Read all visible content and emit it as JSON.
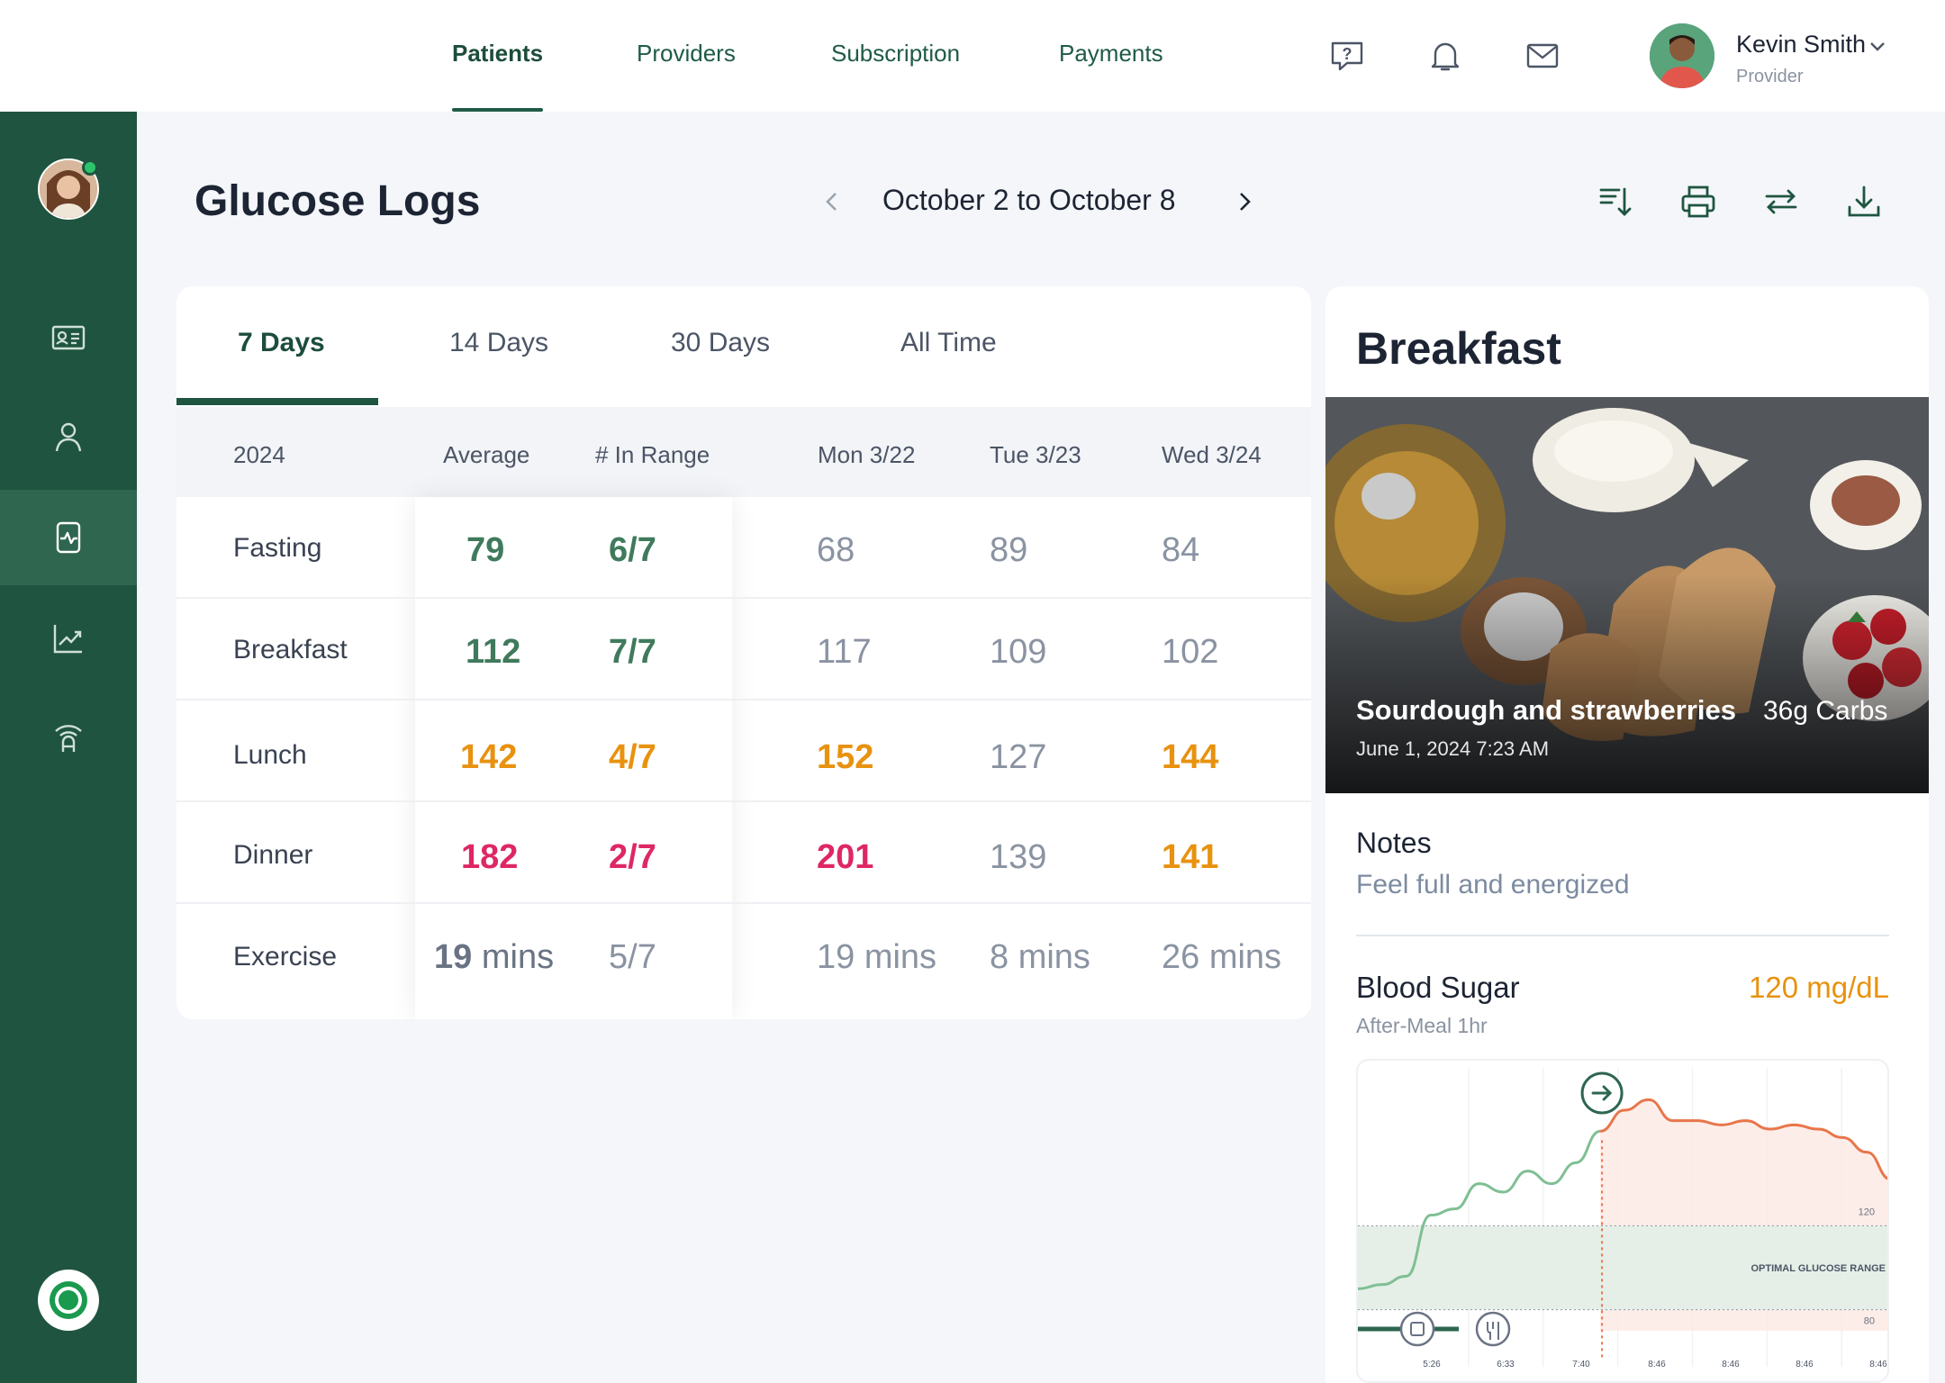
{
  "topnav": {
    "tabs": [
      {
        "label": "Patients",
        "active": true
      },
      {
        "label": "Providers"
      },
      {
        "label": "Subscription"
      },
      {
        "label": "Payments"
      }
    ],
    "icons": [
      "help-icon",
      "bell-icon",
      "mail-icon"
    ],
    "user": {
      "name": "Kevin Smith",
      "role": "Provider"
    }
  },
  "sidebar": {
    "items": [
      {
        "icon": "id-card-icon"
      },
      {
        "icon": "user-icon"
      },
      {
        "icon": "health-log-icon",
        "active": true
      },
      {
        "icon": "trend-chart-icon"
      },
      {
        "icon": "wifi-device-icon"
      }
    ],
    "online": true
  },
  "header": {
    "title": "Glucose Logs",
    "date_range": "October 2 to October 8",
    "tools": [
      "sort-icon",
      "print-icon",
      "swap-icon",
      "download-icon"
    ]
  },
  "logs": {
    "tabs": [
      {
        "label": "7 Days",
        "active": true
      },
      {
        "label": "14 Days"
      },
      {
        "label": "30 Days"
      },
      {
        "label": "All Time"
      }
    ],
    "columns": [
      "2024",
      "Average",
      "# In Range",
      "Mon 3/22",
      "Tue 3/23",
      "Wed 3/24"
    ],
    "rows": [
      {
        "label": "Fasting",
        "avg": "79",
        "range": "6/7",
        "mon": "68",
        "tue": "89",
        "wed": "84"
      },
      {
        "label": "Breakfast",
        "avg": "112",
        "range": "7/7",
        "mon": "117",
        "tue": "109",
        "wed": "102"
      },
      {
        "label": "Lunch",
        "avg": "142",
        "range": "4/7",
        "mon": "152",
        "tue": "127",
        "wed": "144"
      },
      {
        "label": "Dinner",
        "avg": "182",
        "range": "2/7",
        "mon": "201",
        "tue": "139",
        "wed": "141"
      },
      {
        "label": "Exercise",
        "avg": "19",
        "avg_unit": "mins",
        "range": "5/7",
        "mon": "19 mins",
        "tue": "8 mins",
        "wed": "26 mins"
      }
    ],
    "colors": {
      "green": "#3f7a5c",
      "orange": "#e8920f",
      "red": "#de2764",
      "grey": "#8a93a1"
    }
  },
  "meal": {
    "title": "Breakfast",
    "name": "Sourdough and strawberries",
    "carbs": "36g Carbs",
    "datetime": "June 1, 2024  7:23 AM",
    "notes_heading": "Notes",
    "notes": "Feel full and energized",
    "blood_sugar_heading": "Blood Sugar",
    "blood_sugar_value": "120 mg/dL",
    "blood_sugar_sub": "After-Meal  1hr"
  },
  "chart_data": {
    "type": "line",
    "x": [
      "5:26",
      "6:33",
      "7:40",
      "8:46",
      "8:46",
      "8:46",
      "8:46"
    ],
    "y_reference_labels": [
      "120",
      "80"
    ],
    "band_label": "OPTIMAL GLUCOSE RANGE",
    "series": [
      {
        "values": [
          90,
          92,
          96,
          125,
          128,
          140,
          136,
          146,
          140,
          150,
          165,
          175,
          180,
          170,
          170,
          168,
          170,
          166,
          168,
          166,
          162,
          155,
          142
        ]
      }
    ],
    "optimal_range": [
      80,
      120
    ],
    "colors": {
      "before": "#7fbf94",
      "after": "#e8764a",
      "band": "#e5efe7"
    }
  }
}
